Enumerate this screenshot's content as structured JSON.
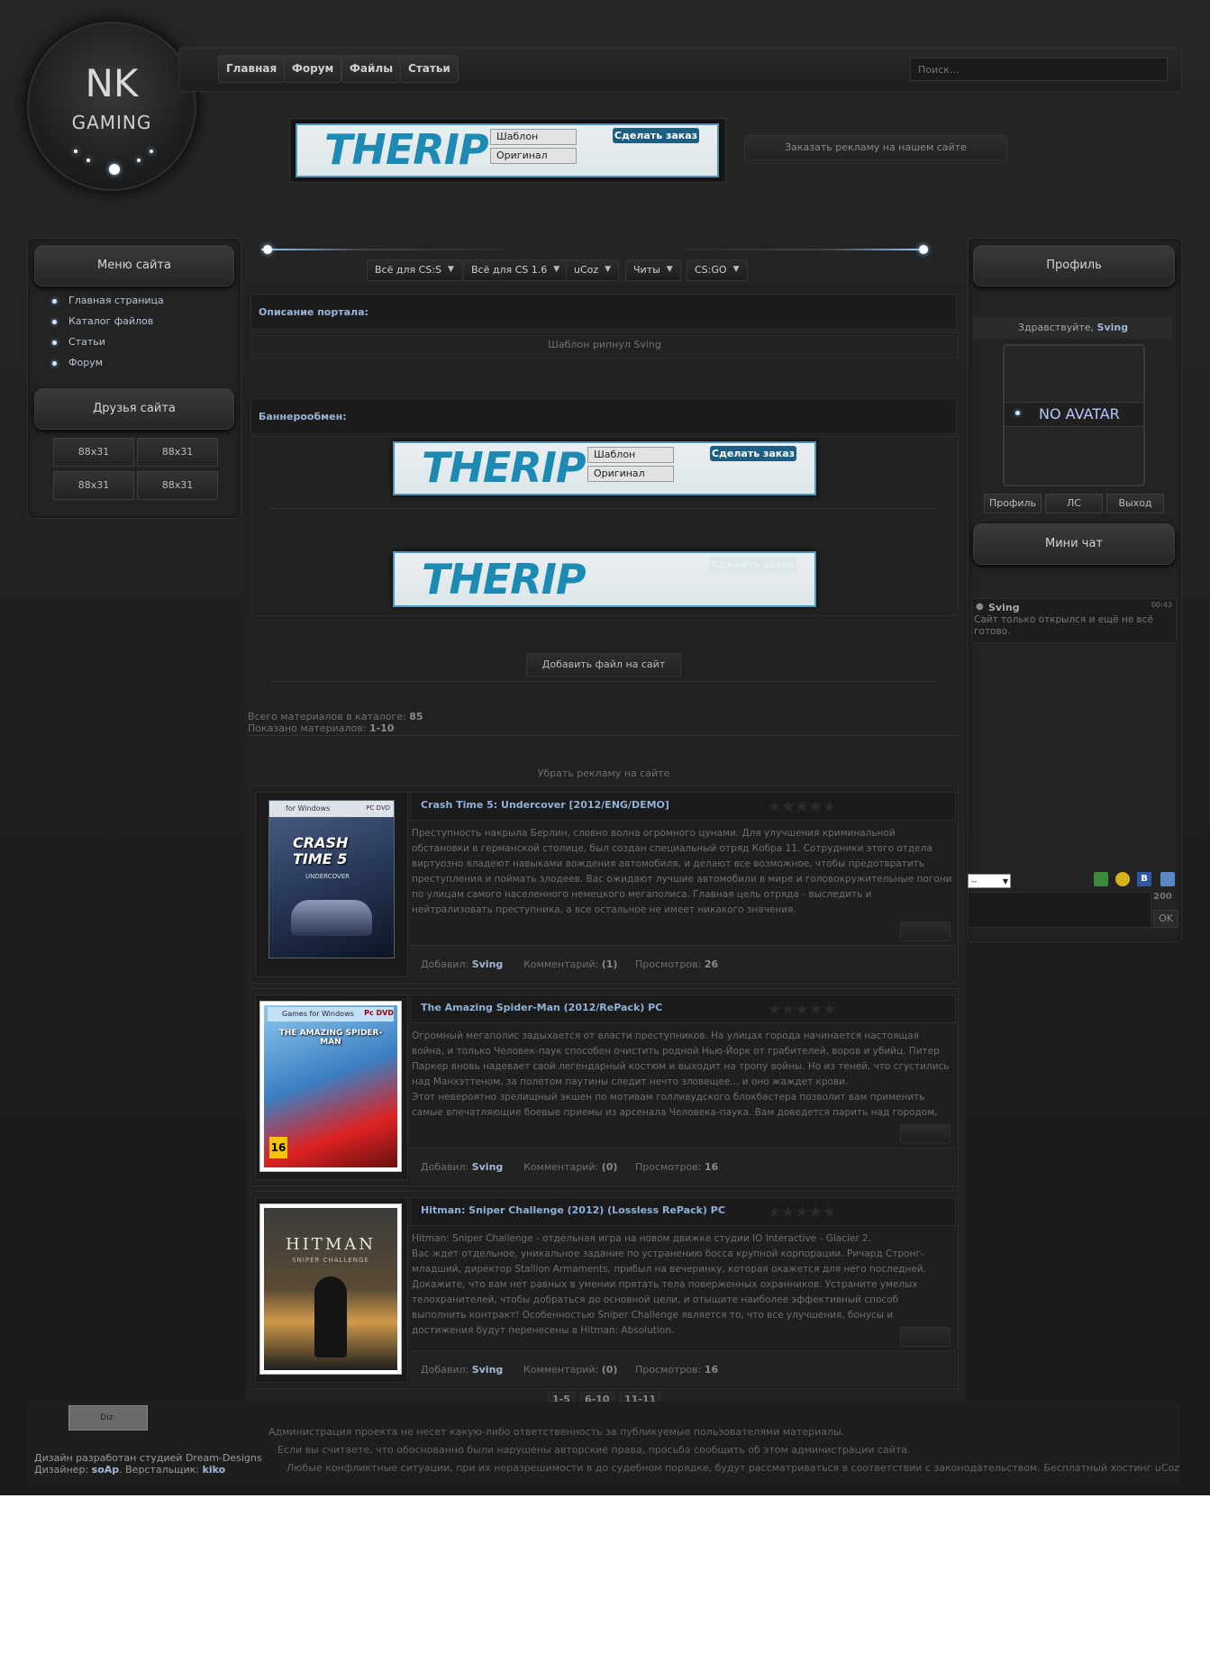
{
  "logo": {
    "line1": "NK",
    "line2": "GAMING"
  },
  "nav": [
    "Главная",
    "Форум",
    "Файлы",
    "Статьи"
  ],
  "search": {
    "placeholder": "Поиск..."
  },
  "banner": {
    "logo_text": "THERIP",
    "option1": "Шаблон",
    "option2": "Оригинал",
    "order_label": "Сделать заказ"
  },
  "ad_order_button": "Заказать рекламу на нашем сайте",
  "left_menu": {
    "title": "Меню сайта",
    "items": [
      "Главная страница",
      "Каталог файлов",
      "Статьи",
      "Форум"
    ],
    "friends_title": "Друзья сайта",
    "friends_buttons": [
      "88x31",
      "88x31",
      "88x31",
      "88x31"
    ]
  },
  "categories": [
    "Всё для CS:S",
    "Всё для CS 1.6",
    "uCoz",
    "Читы",
    "CS:GO"
  ],
  "portal": {
    "heading": "Описание портала:",
    "text": "Шаблон рипнул Sving"
  },
  "banner_exchange": {
    "heading": "Баннерообмен:"
  },
  "add_file_button": "Добавить файл на сайт",
  "catalog_stats": {
    "total_label": "Всего материалов в каталоге:",
    "total": "85",
    "shown_label": "Показано материалов:",
    "shown": "1-10"
  },
  "remove_ads": "Убрать рекламу на сайте",
  "labels": {
    "added": "Добавил:",
    "comments": "Комментарий:",
    "views": "Просмотров:"
  },
  "entries": [
    {
      "title": "Crash Time 5: Undercover [2012/ENG/DEMO]",
      "text": "Преступность накрыла Берлин, словно волна огромного цунами. Для улучшения криминальной обстановки в германской столице, был создан специальный отряд Кобра 11. Сотрудники этого отдела виртуозно владеют навыками вождения автомобиля, и делают все возможное, чтобы предотвратить преступления и поймать злодеев. Вас ожидают лучшие автомобили в мире и головокружительные погони по улицам самого населенного немецкого мегаполиса. Главная цель отряда - выследить и нейтрализовать преступника, а все остальное не имеет никакого значения.",
      "author": "Sving",
      "comments": "(1)",
      "views": "26",
      "cover_top": "for Windows",
      "cover_badge": "PC DVD",
      "cover_title": "CRASH TIME 5",
      "cover_sub": "UNDERCOVER"
    },
    {
      "title": "The Amazing Spider-Man (2012/RePack) PC",
      "text": "Огромный мегаполис задыхается от власти преступников. На улицах города начинается настоящая война, и только Человек-паук способен очистить родной Нью-Йорк от грабителей, воров и убийц. Питер Паркер вновь надевает свой легендарный костюм и выходит на тропу войны. Но из теней, что сгустились над Манхэттеном, за полетом паутины следит нечто зловещее... и оно жаждет крови.\nЭтот невероятно зрелищный экшен по мотивам голливудского блокбастера позволит вам применить самые впечатляющие боевые приемы из арсенала Человека-паука. Вам доведется парить над городом, прыгать по",
      "author": "Sving",
      "comments": "(0)",
      "views": "16",
      "cover_top": "Games for Windows",
      "cover_badge": "Pc DVD",
      "cover_title": "THE AMAZING SPIDER-MAN",
      "cover_age": "16"
    },
    {
      "title": "Hitman: Sniper Challenge (2012) (Lossless RePack) PC",
      "text": "Hitman: Sniper Challenge - отдельная игра на новом движке студии IO Interactive - Glacier 2.\nВас ждет отдельное, уникальное задание по устранению босса крупной корпорации. Ричард Стронг-младший, директор Stallion Armaments, прибыл на вечеринку, которая окажется для него последней. Докажите, что вам нет равных в умении прятать тела поверженных охранников. Устраните умелых телохранителей, чтобы добраться до основной цели, и отыщите наиболее эффективный способ выполнить контракт! Особенностью Sniper Challenge является то, что все улучшения, бонусы и достижения будут перенесены в Hitman: Absolution.",
      "author": "Sving",
      "comments": "(0)",
      "views": "16",
      "cover_title": "HITMAN",
      "cover_sub": "SNIPER CHALLENGE"
    }
  ],
  "pagination": [
    "1-5",
    "6-10",
    "11-11"
  ],
  "profile": {
    "title": "Профиль",
    "greeting": "Здравствуйте,",
    "username": "Sving",
    "avatar_text": "NO AVATAR",
    "buttons": [
      "Профиль",
      "ЛС",
      "Выход"
    ]
  },
  "minichat": {
    "title": "Мини чат",
    "messages": [
      {
        "user": "Sving",
        "time": "00:43",
        "text": "Сайт только открылся и ещё не всё готово."
      }
    ],
    "select_value": "--",
    "char_count": "200",
    "ok_label": "OK"
  },
  "footer": {
    "counter_text": "Diz-ucoztrack.at.ua",
    "credits_line1": "Дизайн разработан студией Dream-Designs",
    "designer_label": "Дизайнер:",
    "designer": "soAp",
    "coder_label": "Верстальщик:",
    "coder": "kiko",
    "disclaimer1": "Администрация проекта не несет какую-либо ответственность за публикуемые пользователями материалы.",
    "disclaimer2": "Если вы считаете, что обоснованно были нарушены авторские права, просьба сообщить об этом администрации сайта.",
    "disclaimer3": "Любые конфликтные ситуации, при их неразрешимости в до судебном порядке, будут рассматриваться в соответствии с законодательством. Бесплатный хостинг uCoz"
  },
  "colors": {
    "accent_link": "#8fb1d8",
    "banner_blue": "#1d8ab3",
    "background": "#1e1e1e"
  }
}
